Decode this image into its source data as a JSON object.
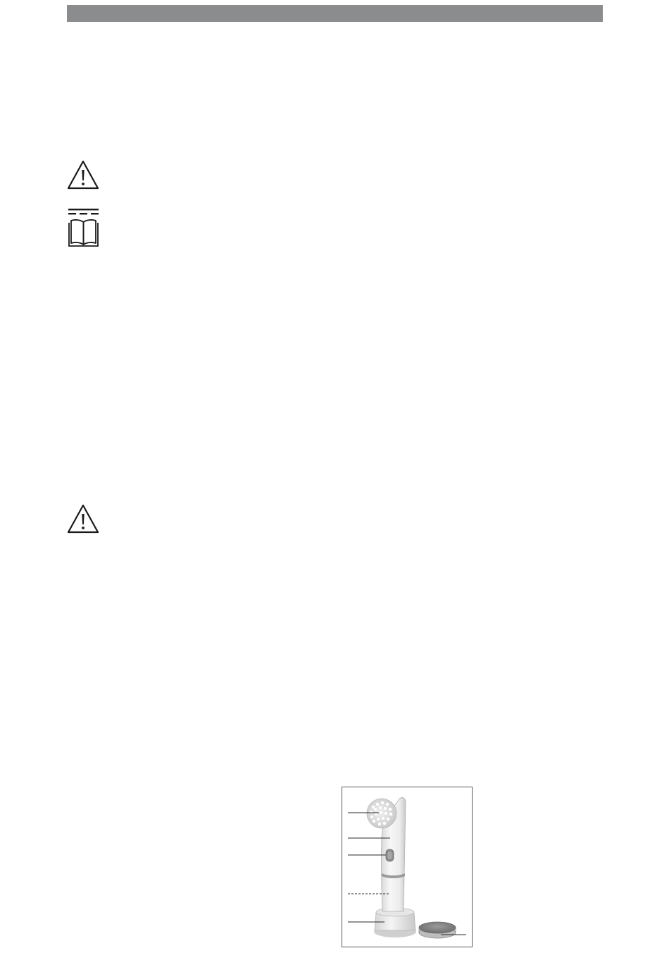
{
  "header": {
    "bar_color": "#8b8c8e"
  },
  "symbols": [
    {
      "icon": "warning-triangle-icon"
    },
    {
      "icon": "read-manual-icon"
    },
    {
      "icon": "warning-triangle-icon"
    }
  ],
  "figure": {
    "subject": "facial-cleansing-brush-device-illustration",
    "callout_count": 6
  }
}
